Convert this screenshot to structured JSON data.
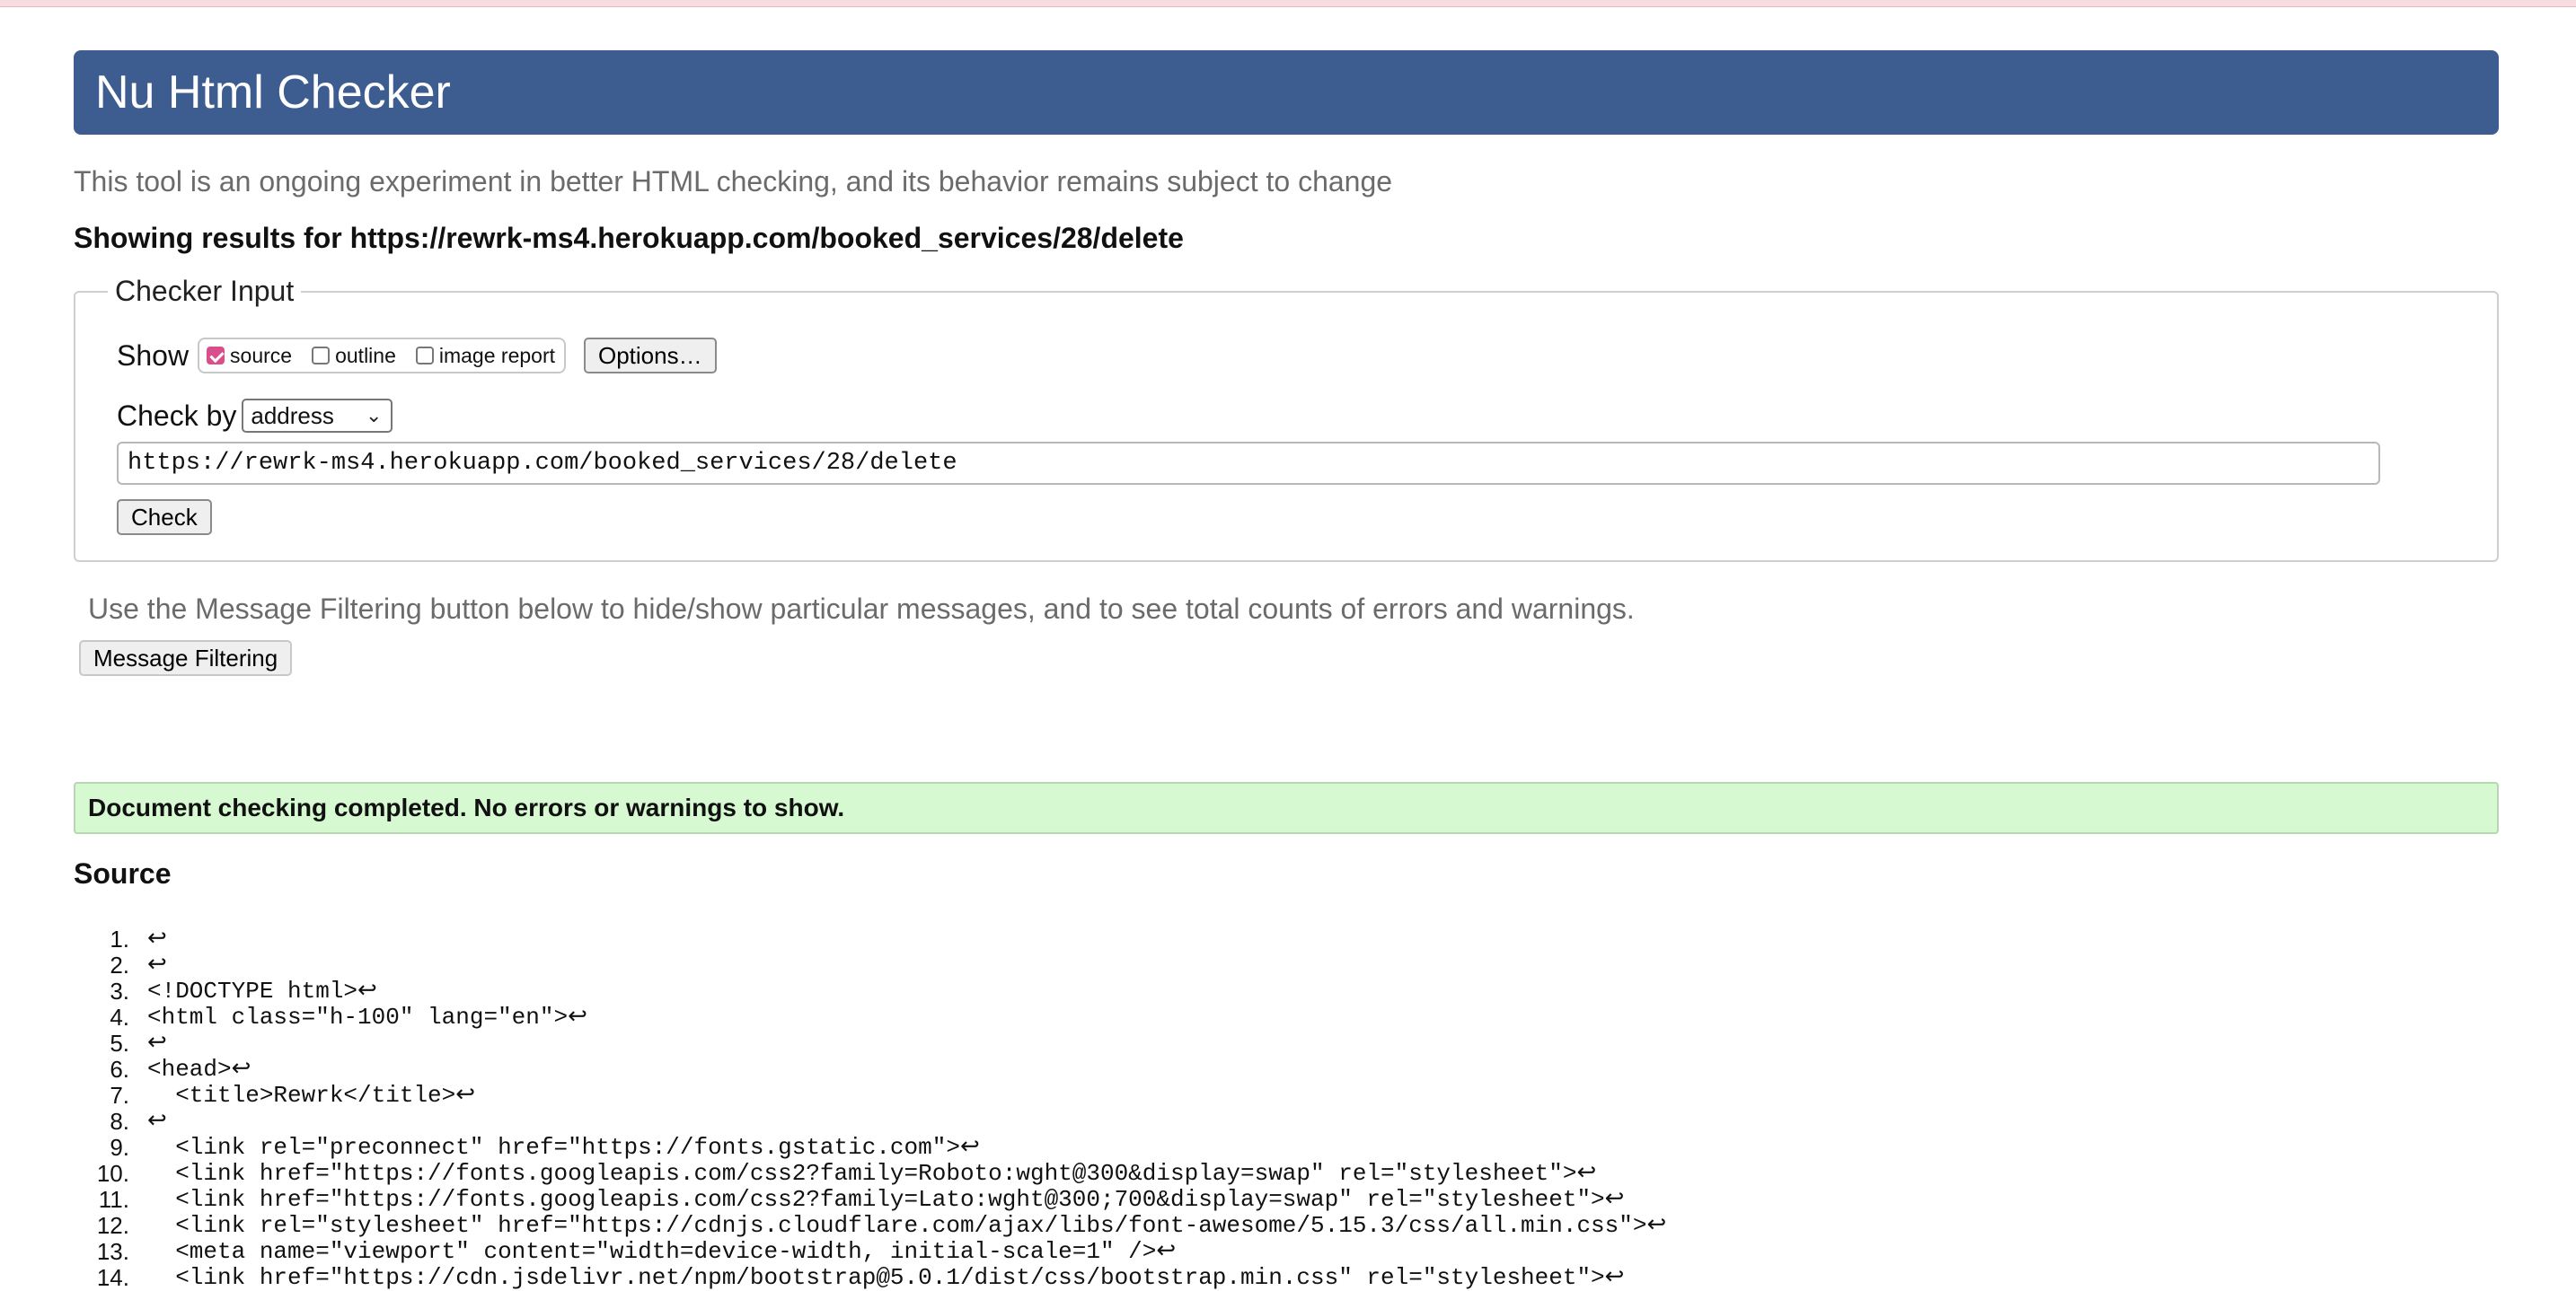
{
  "header": {
    "title": "Nu Html Checker"
  },
  "intro_text": "This tool is an ongoing experiment in better HTML checking, and its behavior remains subject to change",
  "results_for": "Showing results for https://rewrk-ms4.herokuapp.com/booked_services/28/delete",
  "checker_input": {
    "legend": "Checker Input",
    "show_label": "Show",
    "options": [
      {
        "label": "source",
        "checked": true
      },
      {
        "label": "outline",
        "checked": false
      },
      {
        "label": "image report",
        "checked": false
      }
    ],
    "options_button": "Options…",
    "check_by_label": "Check by",
    "check_by_value": "address",
    "url_value": "https://rewrk-ms4.herokuapp.com/booked_services/28/delete",
    "check_button": "Check"
  },
  "filter_note": "Use the Message Filtering button below to hide/show particular messages, and to see total counts of errors and warnings.",
  "filter_button": "Message Filtering",
  "success_message": "Document checking completed. No errors or warnings to show.",
  "source_heading": "Source",
  "source_lines": [
    {
      "n": "1.",
      "code": "↩"
    },
    {
      "n": "2.",
      "code": "↩"
    },
    {
      "n": "3.",
      "code": "<!DOCTYPE html>↩"
    },
    {
      "n": "4.",
      "code": "<html class=\"h-100\" lang=\"en\">↩"
    },
    {
      "n": "5.",
      "code": "↩"
    },
    {
      "n": "6.",
      "code": "<head>↩"
    },
    {
      "n": "7.",
      "code": "  <title>Rewrk</title>↩"
    },
    {
      "n": "8.",
      "code": "↩"
    },
    {
      "n": "9.",
      "code": "  <link rel=\"preconnect\" href=\"https://fonts.gstatic.com\">↩"
    },
    {
      "n": "10.",
      "code": "  <link href=\"https://fonts.googleapis.com/css2?family=Roboto:wght@300&display=swap\" rel=\"stylesheet\">↩"
    },
    {
      "n": "11.",
      "code": "  <link href=\"https://fonts.googleapis.com/css2?family=Lato:wght@300;700&display=swap\" rel=\"stylesheet\">↩"
    },
    {
      "n": "12.",
      "code": "  <link rel=\"stylesheet\" href=\"https://cdnjs.cloudflare.com/ajax/libs/font-awesome/5.15.3/css/all.min.css\">↩"
    },
    {
      "n": "13.",
      "code": "  <meta name=\"viewport\" content=\"width=device-width, initial-scale=1\" />↩"
    },
    {
      "n": "14.",
      "code": "  <link href=\"https://cdn.jsdelivr.net/npm/bootstrap@5.0.1/dist/css/bootstrap.min.css\" rel=\"stylesheet\">↩"
    }
  ]
}
